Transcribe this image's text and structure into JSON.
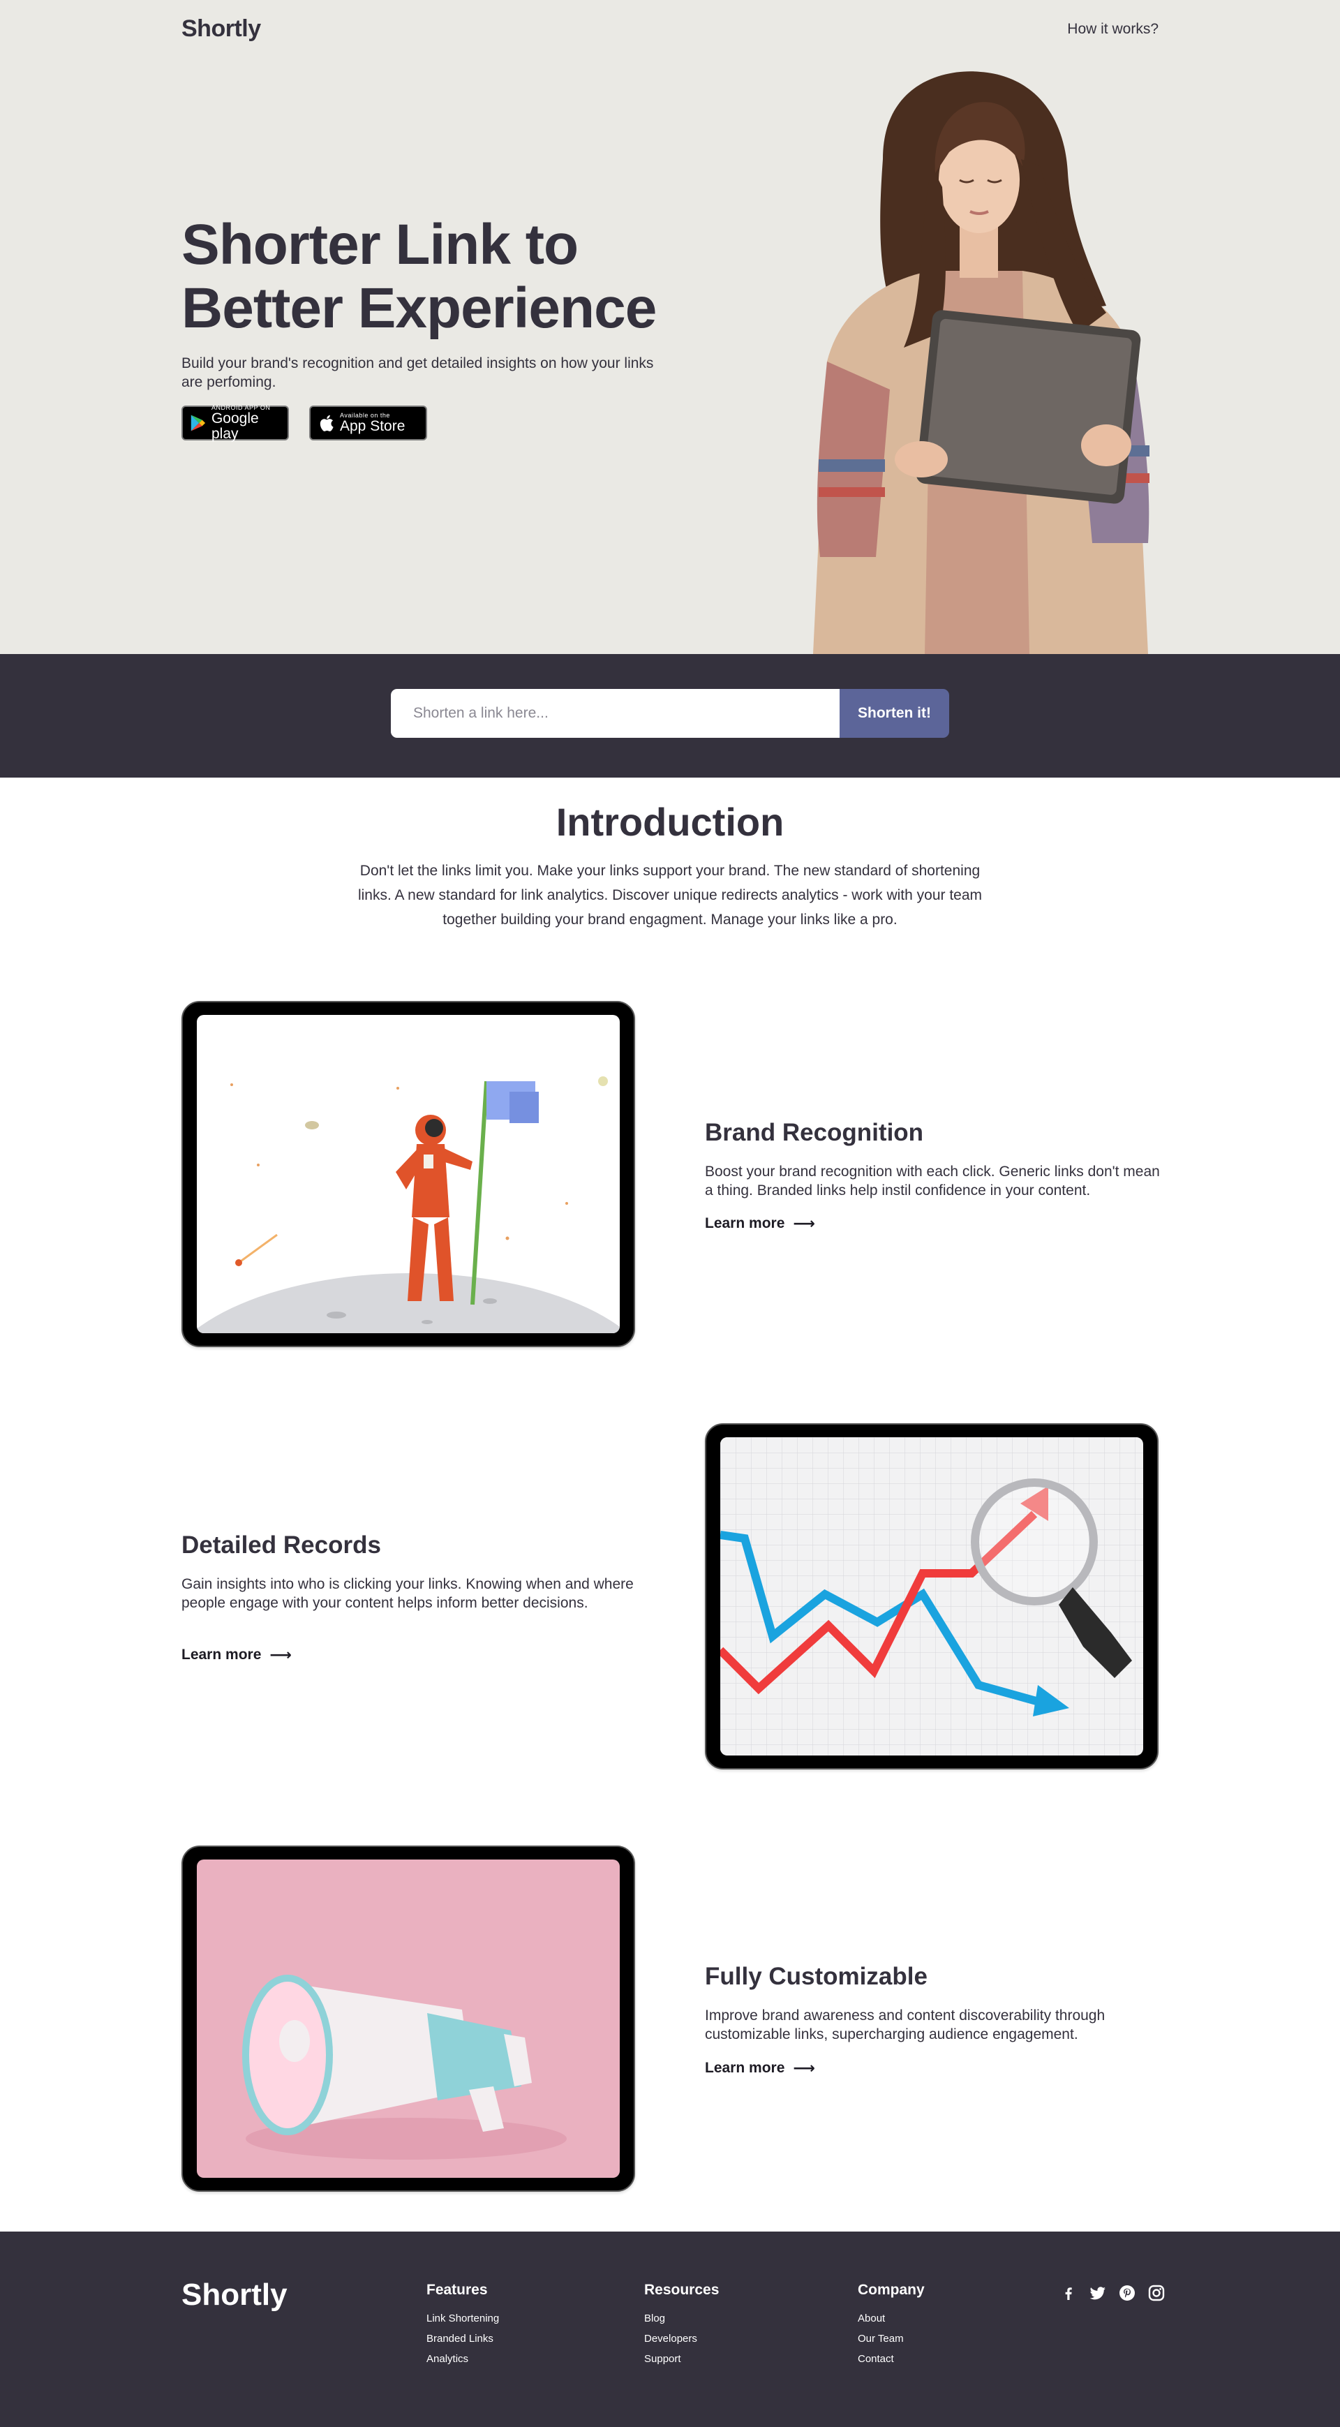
{
  "header": {
    "logo": "Shortly",
    "nav_link": "How it works?"
  },
  "hero": {
    "title": "Shorter Link to Better Experience",
    "text": "Build your brand's recognition and get detailed insights on how your links are perfoming.",
    "google_play": {
      "small": "ANDROID APP ON",
      "big": "Google play"
    },
    "app_store": {
      "small": "Available on the",
      "big": "App Store"
    }
  },
  "shorten": {
    "placeholder": "Shorten a link here...",
    "button": "Shorten it!"
  },
  "intro": {
    "title": "Introduction",
    "text": "Don't let the links limit you. Make your links support your brand. The new standard of shortening links. A new standard for link analytics. Discover unique redirects analytics - work with your team together building your brand engagment. Manage your links like a pro."
  },
  "features": [
    {
      "title": "Brand Recognition",
      "text": "Boost your brand recognition with each click. Generic links don't mean a thing. Branded links help instil confidence in your content.",
      "link": "Learn more",
      "arrow": "⟶"
    },
    {
      "title": "Detailed Records",
      "text": "Gain insights into who is clicking your links. Knowing when and where people engage with your content helps inform better decisions.",
      "link": "Learn more",
      "arrow": "⟶"
    },
    {
      "title": "Fully Customizable",
      "text": "Improve brand awareness and content discoverability through customizable links, supercharging audience engagement.",
      "link": "Learn more",
      "arrow": "⟶"
    }
  ],
  "footer": {
    "logo": "Shortly",
    "columns": [
      {
        "title": "Features",
        "links": [
          "Link Shortening",
          "Branded Links",
          "Analytics"
        ]
      },
      {
        "title": "Resources",
        "links": [
          "Blog",
          "Developers",
          "Support"
        ]
      },
      {
        "title": "Company",
        "links": [
          "About",
          "Our Team",
          "Contact"
        ]
      }
    ],
    "social": [
      "facebook-icon",
      "twitter-icon",
      "pinterest-icon",
      "instagram-icon"
    ]
  },
  "colors": {
    "hero_bg": "#eae9e4",
    "dark": "#34313d",
    "button": "#5c6599"
  }
}
